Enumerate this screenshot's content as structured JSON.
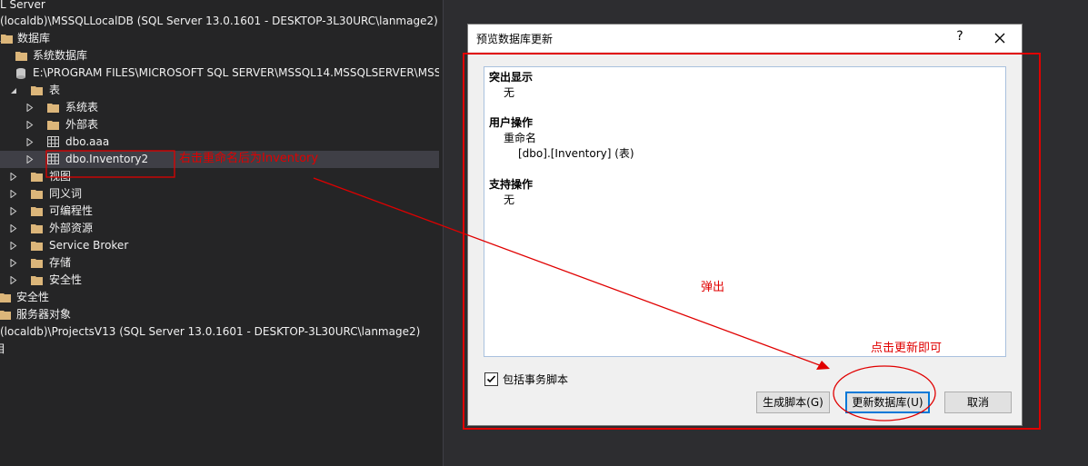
{
  "explorer": {
    "rows": [
      {
        "label": "L Server"
      },
      {
        "label": "(localdb)\\MSSQLLocalDB (SQL Server 13.0.1601 - DESKTOP-3L30URC\\lanmage2)"
      },
      {
        "label": "数据库"
      },
      {
        "label": "系统数据库"
      },
      {
        "label": "E:\\PROGRAM FILES\\MICROSOFT SQL SERVER\\MSSQL14.MSSQLSERVER\\MSS"
      },
      {
        "label": "表"
      },
      {
        "label": "系统表"
      },
      {
        "label": "外部表"
      },
      {
        "label": "dbo.aaa"
      },
      {
        "label": "dbo.Inventory2"
      },
      {
        "label": "视图"
      },
      {
        "label": "同义词"
      },
      {
        "label": "可编程性"
      },
      {
        "label": "外部资源"
      },
      {
        "label": "Service Broker"
      },
      {
        "label": "存储"
      },
      {
        "label": "安全性"
      },
      {
        "label": "安全性"
      },
      {
        "label": "服务器对象"
      },
      {
        "label": "(localdb)\\ProjectsV13 (SQL Server 13.0.1601 - DESKTOP-3L30URC\\lanmage2)"
      },
      {
        "label": "目"
      }
    ]
  },
  "dialog": {
    "title": "预览数据库更新",
    "help": "?",
    "sections": {
      "highlight_header": "突出显示",
      "highlight_value": "无",
      "user_header": "用户操作",
      "user_action": "重命名",
      "user_object": "[dbo].[Inventory] (表)",
      "support_header": "支持操作",
      "support_value": "无"
    },
    "include_script_label": "包括事务脚本",
    "include_script_checked": true,
    "buttons": {
      "generate": "生成脚本(G)",
      "update": "更新数据库(U)",
      "cancel": "取消"
    }
  },
  "annotations": {
    "rename_note": "右击重命名后为Inventory",
    "popup_note": "弹出",
    "click_note": "点击更新即可",
    "color": "#e00000"
  }
}
